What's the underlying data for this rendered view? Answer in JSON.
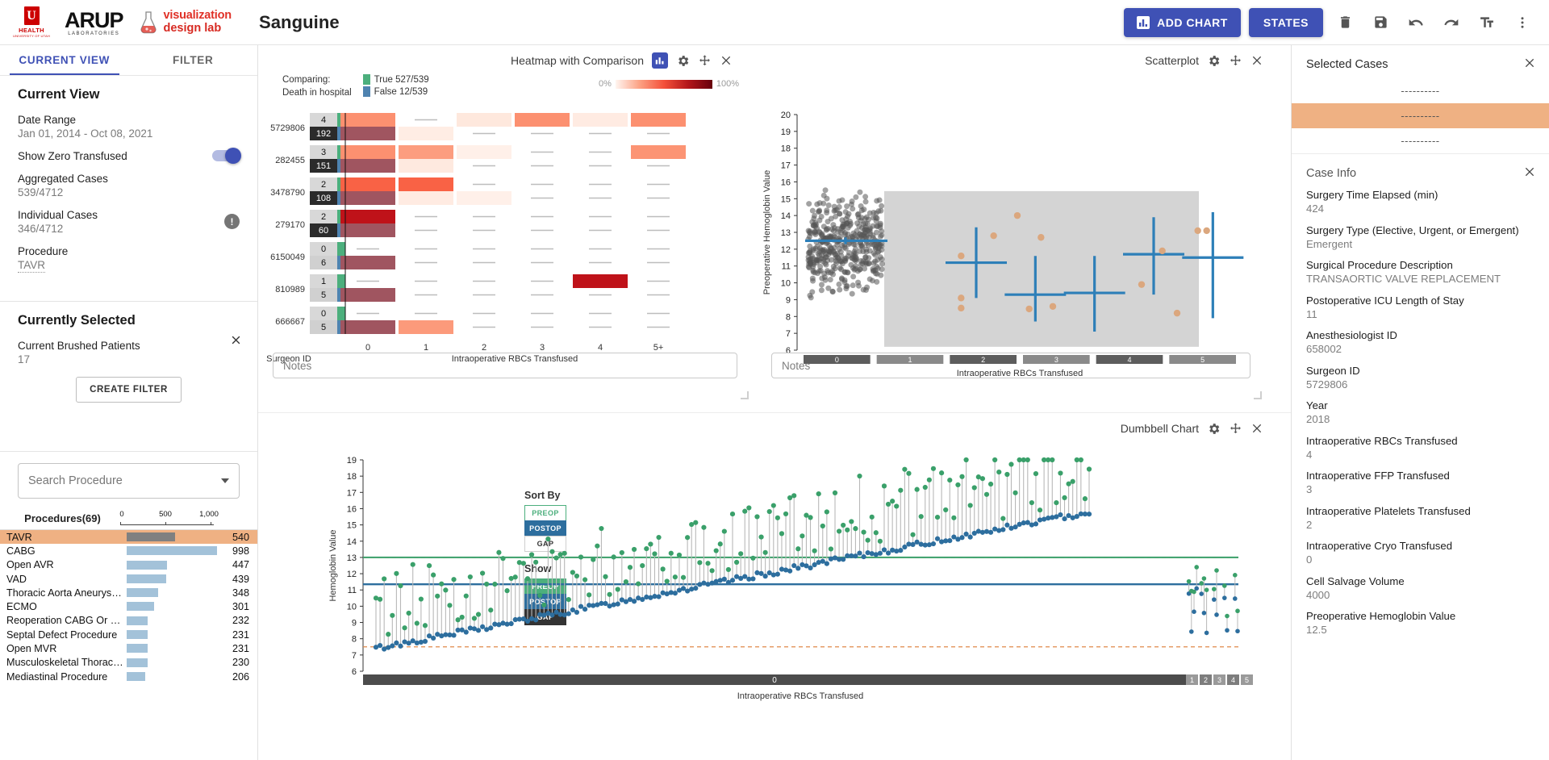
{
  "app": {
    "title": "Sanguine",
    "logo_u": "U",
    "logo_uhealth": "HEALTH",
    "logo_uhealth_sub": "UNIVERSITY OF UTAH",
    "logo_arup": "ARUP",
    "logo_arup_sub": "LABORATORIES",
    "logo_vdl_line1": "visualization",
    "logo_vdl_line2": "design lab"
  },
  "toolbar": {
    "add_chart": "ADD CHART",
    "states": "STATES",
    "icons": [
      "trash-icon",
      "save-icon",
      "undo-icon",
      "redo-icon",
      "text-size-icon",
      "more-vert-icon"
    ]
  },
  "sidebar": {
    "tabs": [
      {
        "label": "CURRENT VIEW",
        "active": true
      },
      {
        "label": "FILTER",
        "active": false
      }
    ],
    "current_view": {
      "heading": "Current View",
      "date_range_label": "Date Range",
      "date_range_value": "Jan 01, 2014 - Oct 08, 2021",
      "show_zero_label": "Show Zero Transfused",
      "show_zero_on": true,
      "aggregated_label": "Aggregated Cases",
      "aggregated_value": "539/4712",
      "individual_label": "Individual Cases",
      "individual_value": "346/4712",
      "procedure_label": "Procedure",
      "procedure_value": "TAVR"
    },
    "currently_selected": {
      "heading": "Currently Selected",
      "brushed_label": "Current Brushed Patients",
      "brushed_value": "17",
      "create_filter": "CREATE FILTER"
    },
    "search_placeholder": "Search Procedure",
    "procedures_header": "Procedures(69)",
    "axis_ticks": [
      "0",
      "500",
      "1,000"
    ],
    "axis_max": 1000,
    "procedures": [
      {
        "name": "TAVR",
        "value": 540,
        "selected": true
      },
      {
        "name": "CABG",
        "value": 998,
        "selected": false
      },
      {
        "name": "Open AVR",
        "value": 447,
        "selected": false
      },
      {
        "name": "VAD",
        "value": 439,
        "selected": false
      },
      {
        "name": "Thoracic Aorta Aneurysm Pro...",
        "value": 348,
        "selected": false
      },
      {
        "name": "ECMO",
        "value": 301,
        "selected": false
      },
      {
        "name": "Reoperation CABG Or Valve Pr...",
        "value": 232,
        "selected": false
      },
      {
        "name": "Septal Defect Procedure",
        "value": 231,
        "selected": false
      },
      {
        "name": "Open MVR",
        "value": 231,
        "selected": false
      },
      {
        "name": "Musculoskeletal Thoracic Pro...",
        "value": 230,
        "selected": false
      },
      {
        "name": "Mediastinal Procedure",
        "value": 206,
        "selected": false
      }
    ]
  },
  "heatmap": {
    "title": "Heatmap with Comparison",
    "comparing_label": "Comparing:",
    "comparing_attribute": "Death in hospital",
    "legend": [
      {
        "label": "True 527/539",
        "color": "#4caf7d"
      },
      {
        "label": "False 12/539",
        "color": "#4f83b0"
      }
    ],
    "scale_min": "0%",
    "scale_max": "100%",
    "y_axis_label": "Surgeon ID",
    "x_axis_label": "Intraoperative RBCs Transfused",
    "x_ticks": [
      "0",
      "1",
      "2",
      "3",
      "4",
      "5+"
    ],
    "notes_placeholder": "Notes",
    "rows": [
      {
        "surgeon": "5729806",
        "top_count": "4",
        "bottom_count": "192",
        "top_cells": [
          0.38,
          0.0,
          0.08,
          0.38,
          0.06,
          0.38
        ],
        "bottom_cells": [
          0.78,
          0.05,
          0.0,
          0.0,
          0.0,
          0.0
        ]
      },
      {
        "surgeon": "282455",
        "top_count": "3",
        "bottom_count": "151",
        "top_cells": [
          0.38,
          0.34,
          0.03,
          0.0,
          0.0,
          0.37
        ],
        "bottom_cells": [
          0.78,
          0.07,
          0.0,
          0.0,
          0.0,
          0.0
        ]
      },
      {
        "surgeon": "3478790",
        "top_count": "2",
        "bottom_count": "108",
        "top_cells": [
          0.52,
          0.52,
          0.0,
          0.0,
          0.0,
          0.0
        ],
        "bottom_cells": [
          0.78,
          0.06,
          0.03,
          0.0,
          0.0,
          0.0
        ]
      },
      {
        "surgeon": "279170",
        "top_count": "2",
        "bottom_count": "60",
        "top_cells": [
          0.78,
          0.0,
          0.0,
          0.0,
          0.0,
          0.0
        ],
        "bottom_cells": [
          0.78,
          0.0,
          0.0,
          0.0,
          0.0,
          0.0
        ]
      },
      {
        "surgeon": "6150049",
        "top_count": "0",
        "bottom_count": "6",
        "top_cells": [
          0.0,
          0.0,
          0.0,
          0.0,
          0.0,
          0.0
        ],
        "bottom_cells": [
          0.78,
          0.0,
          0.0,
          0.0,
          0.0,
          0.0
        ]
      },
      {
        "surgeon": "810989",
        "top_count": "1",
        "bottom_count": "5",
        "top_cells": [
          0.0,
          0.0,
          0.0,
          0.0,
          0.78,
          0.0
        ],
        "bottom_cells": [
          0.78,
          0.0,
          0.0,
          0.0,
          0.0,
          0.0
        ]
      },
      {
        "surgeon": "666667",
        "top_count": "0",
        "bottom_count": "5",
        "top_cells": [
          0.0,
          0.0,
          0.0,
          0.0,
          0.0,
          0.0
        ],
        "bottom_cells": [
          0.78,
          0.35,
          0.0,
          0.0,
          0.0,
          0.0
        ]
      }
    ]
  },
  "scatterplot": {
    "title": "Scatterplot",
    "y_axis_label": "Preoperative Hemoglobin Value",
    "x_axis_label": "Intraoperative RBCs Transfused",
    "y_ticks": [
      20,
      19,
      18,
      17,
      16,
      15,
      14,
      13,
      12,
      11,
      10,
      9,
      8,
      7,
      6
    ],
    "y_range": [
      6,
      20
    ],
    "x_ticks": [
      "0",
      "1",
      "2",
      "3",
      "4",
      "5"
    ],
    "notes_placeholder": "Notes",
    "group_medians": [
      12.5,
      11.2,
      9.3,
      9.4,
      11.7,
      11.5
    ],
    "group_iqr": [
      [
        12.3,
        12.7
      ],
      [
        9.1,
        13.3
      ],
      [
        7.7,
        11.6
      ],
      [
        7.1,
        11.6
      ],
      [
        9.3,
        13.9
      ],
      [
        7.9,
        14.2
      ]
    ],
    "highlight_points": [
      {
        "x": 1,
        "y": 11.6
      },
      {
        "x": 1,
        "y": 9.1
      },
      {
        "x": 1,
        "y": 8.5
      },
      {
        "x": 1.55,
        "y": 12.8
      },
      {
        "x": 1.95,
        "y": 14.0
      },
      {
        "x": 2.35,
        "y": 12.7
      },
      {
        "x": 2.55,
        "y": 8.6
      },
      {
        "x": 2.15,
        "y": 8.45
      },
      {
        "x": 4.4,
        "y": 11.9
      },
      {
        "x": 4.05,
        "y": 9.9
      },
      {
        "x": 5.0,
        "y": 13.1
      },
      {
        "x": 5.15,
        "y": 13.1
      },
      {
        "x": 4.65,
        "y": 8.2
      }
    ]
  },
  "dumbbell": {
    "title": "Dumbbell Chart",
    "y_axis_label": "Hemoglobin Value",
    "x_axis_label": "Intraoperative RBCs Transfused",
    "y_ticks": [
      19,
      18,
      17,
      16,
      15,
      14,
      13,
      12,
      11,
      10,
      9,
      8,
      7,
      6
    ],
    "y_range": [
      6,
      19
    ],
    "x_group_labels": [
      "0",
      "1",
      "2",
      "3",
      "4",
      "5"
    ],
    "sort_by_label": "Sort By",
    "show_label": "Show",
    "sort_options": [
      {
        "label": "PREOP",
        "state": "green"
      },
      {
        "label": "POSTOP",
        "state": "blue-active"
      },
      {
        "label": "GAP",
        "state": "plain"
      }
    ],
    "show_options": [
      {
        "label": "PREOP",
        "state": "green"
      },
      {
        "label": "POSTOP",
        "state": "blue"
      },
      {
        "label": "GAP",
        "state": "dark"
      }
    ],
    "ref_lines": {
      "preop_mean": 13.0,
      "postop_mean": 11.3,
      "lower": 7.5,
      "upper": 13.0
    }
  },
  "rightbar": {
    "selected_cases_title": "Selected Cases",
    "cases": [
      {
        "label": "----------",
        "selected": false
      },
      {
        "label": "----------",
        "selected": true
      },
      {
        "label": "----------",
        "selected": false
      }
    ],
    "case_info_title": "Case Info",
    "info": [
      {
        "key": "Surgery Time Elapsed (min)",
        "value": "424"
      },
      {
        "key": "Surgery Type (Elective, Urgent, or Emergent)",
        "value": "Emergent"
      },
      {
        "key": "Surgical Procedure Description",
        "value": "TRANSAORTIC VALVE REPLACEMENT"
      },
      {
        "key": "Postoperative ICU Length of Stay",
        "value": "11"
      },
      {
        "key": "Anesthesiologist ID",
        "value": "658002"
      },
      {
        "key": "Surgeon ID",
        "value": "5729806"
      },
      {
        "key": "Year",
        "value": "2018"
      },
      {
        "key": "Intraoperative RBCs Transfused",
        "value": "4"
      },
      {
        "key": "Intraoperative FFP Transfused",
        "value": "3"
      },
      {
        "key": "Intraoperative Platelets Transfused",
        "value": "2"
      },
      {
        "key": "Intraoperative Cryo Transfused",
        "value": "0"
      },
      {
        "key": "Cell Salvage Volume",
        "value": "4000"
      },
      {
        "key": "Preoperative Hemoglobin Value",
        "value": "12.5"
      }
    ]
  },
  "colors": {
    "primary": "#3f51b5",
    "selected_row": "#efb183",
    "green": "#4caf7d",
    "blue": "#2d6e9e",
    "bar_blue": "#a3c2d9"
  }
}
